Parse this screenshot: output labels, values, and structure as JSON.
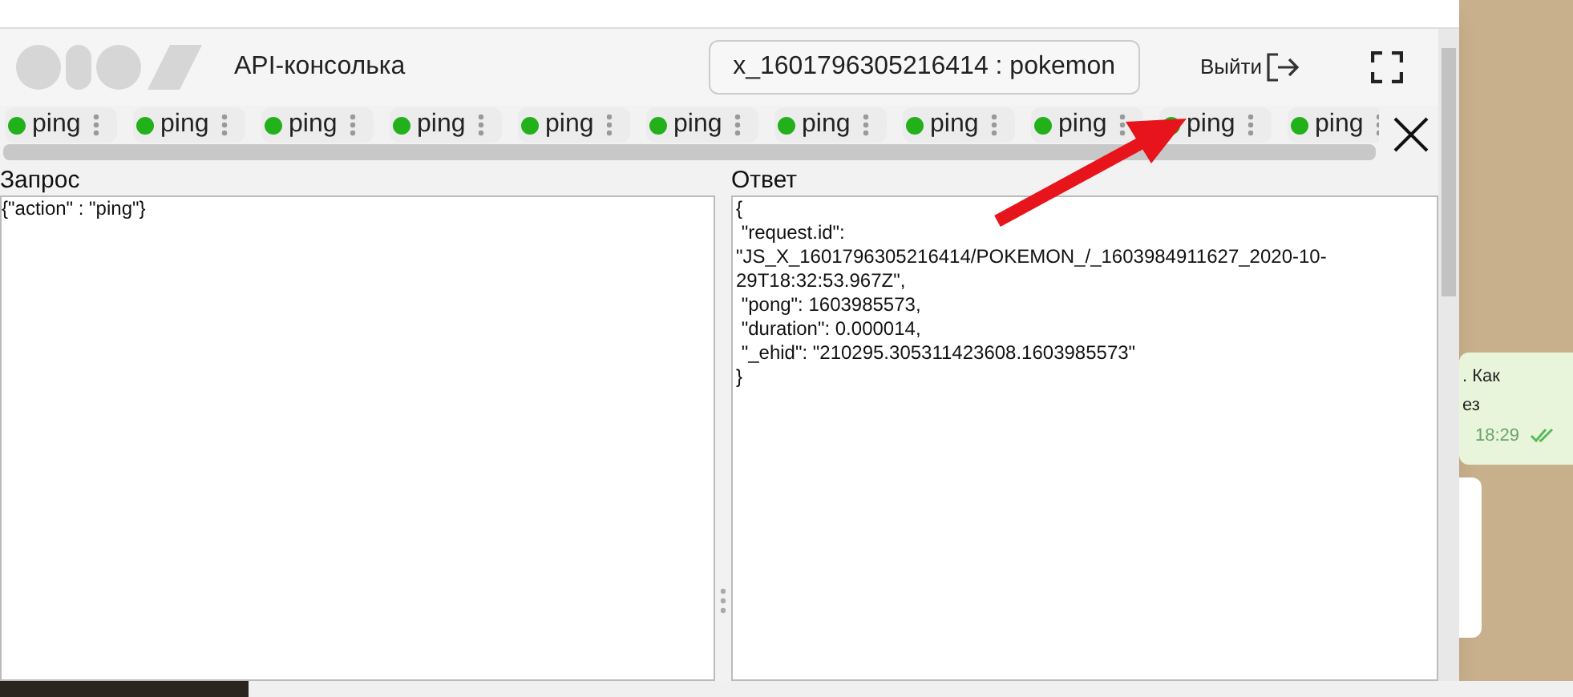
{
  "header": {
    "title": "API-консолька",
    "session": "x_1601796305216414 : pokemon",
    "logout": "Выйти"
  },
  "tabs": [
    {
      "label": "ping"
    },
    {
      "label": "ping"
    },
    {
      "label": "ping"
    },
    {
      "label": "ping"
    },
    {
      "label": "ping"
    },
    {
      "label": "ping"
    },
    {
      "label": "ping"
    },
    {
      "label": "ping"
    },
    {
      "label": "ping"
    },
    {
      "label": "ping"
    },
    {
      "label": "ping"
    }
  ],
  "request": {
    "label": "Запрос",
    "value": "{\"action\" : \"ping\"}"
  },
  "response": {
    "label": "Ответ",
    "lines": [
      "{",
      " \"request.id\":",
      "\"JS_X_1601796305216414/POKEMON_/_1603984911627_2020-10-",
      "29T18:32:53.967Z\",",
      " \"pong\": 1603985573,",
      " \"duration\": 0.000014,",
      " \"_ehid\": \"210295.305311423608.1603985573\"",
      "}"
    ]
  },
  "chat_bubble": {
    "lines": [
      ". Как",
      "ез"
    ],
    "time": "18:29"
  }
}
